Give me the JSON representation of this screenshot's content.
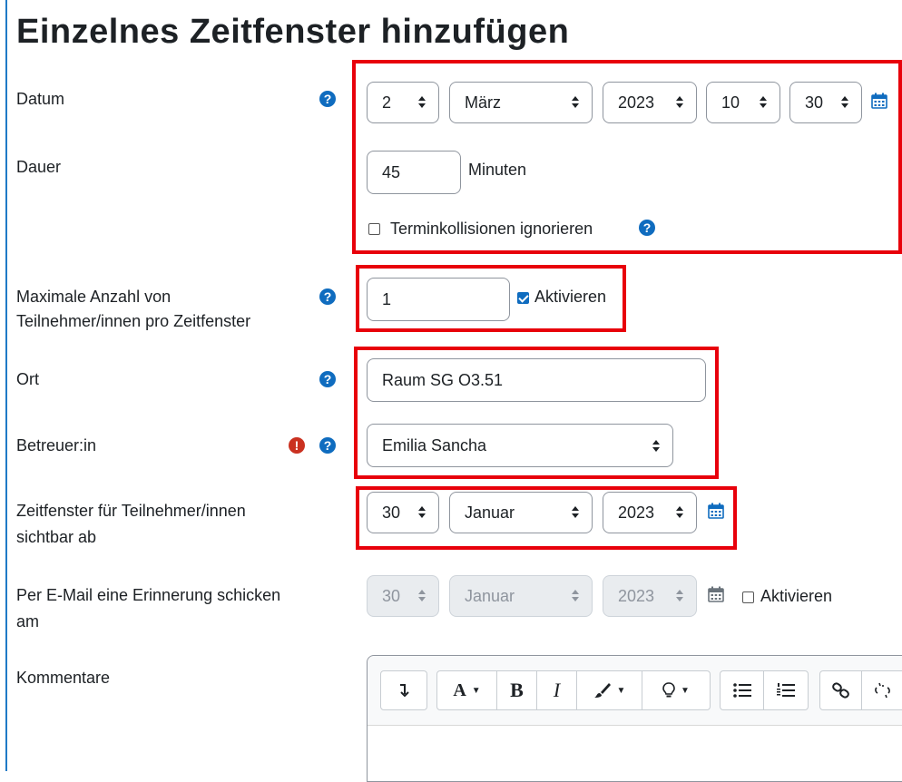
{
  "title": "Einzelnes Zeitfenster hinzufügen",
  "date": {
    "label": "Datum",
    "day": "2",
    "month": "März",
    "year": "2023",
    "hour": "10",
    "minute": "30"
  },
  "duration": {
    "label": "Dauer",
    "value": "45",
    "unit": "Minuten",
    "ignore_conflicts_label": "Terminkollisionen ignorieren"
  },
  "max_participants": {
    "label_line1": "Maximale Anzahl von",
    "label_line2": "Teilnehmer/innen pro Zeitfenster",
    "value": "1",
    "enable_label": "Aktivieren"
  },
  "location": {
    "label": "Ort",
    "value": "Raum SG O3.51"
  },
  "supervisor": {
    "label": "Betreuer:in",
    "value": "Emilia Sancha"
  },
  "visible_from": {
    "label_line1": "Zeitfenster für Teilnehmer/innen",
    "label_line2": "sichtbar ab",
    "day": "30",
    "month": "Januar",
    "year": "2023"
  },
  "reminder": {
    "label_line1": "Per E-Mail eine Erinnerung schicken",
    "label_line2": "am",
    "day": "30",
    "month": "Januar",
    "year": "2023",
    "enable_label": "Aktivieren"
  },
  "comments": {
    "label": "Kommentare"
  },
  "toolbar": {
    "bold": "B",
    "italic": "I",
    "font_color": "A"
  },
  "colors": {
    "accent": "#0f6cbf",
    "highlight_border": "#e8000b",
    "error": "#ca3120"
  }
}
